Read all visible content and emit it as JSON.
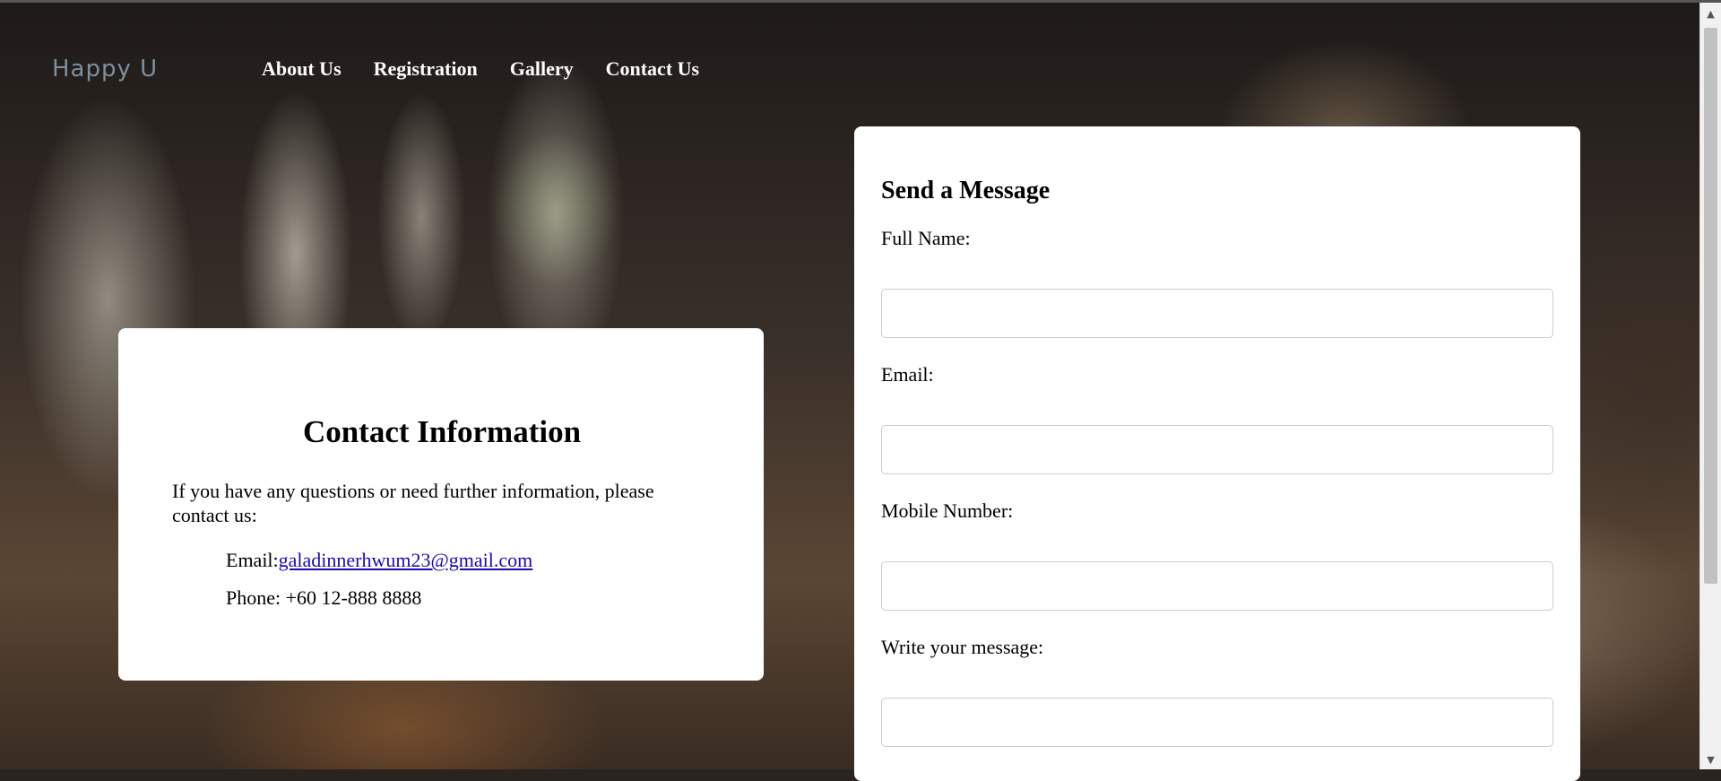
{
  "nav": {
    "logo": "Happy U",
    "items": [
      "About Us",
      "Registration",
      "Gallery",
      "Contact Us"
    ]
  },
  "contact_info": {
    "title": "Contact Information",
    "intro": "If you have any questions or need further information, please contact us:",
    "email_label": "Email:",
    "email": "galadinnerhwum23@gmail.com",
    "phone": "Phone: +60 12-888 8888"
  },
  "form": {
    "title": "Send a Message",
    "full_name_label": "Full Name:",
    "email_label": "Email:",
    "mobile_label": "Mobile Number:",
    "message_label": "Write your message:",
    "full_name_value": "",
    "email_value": "",
    "mobile_value": "",
    "message_value": ""
  },
  "scrollbar": {
    "up_icon": "triangle-up-icon",
    "down_icon": "triangle-down-icon"
  }
}
